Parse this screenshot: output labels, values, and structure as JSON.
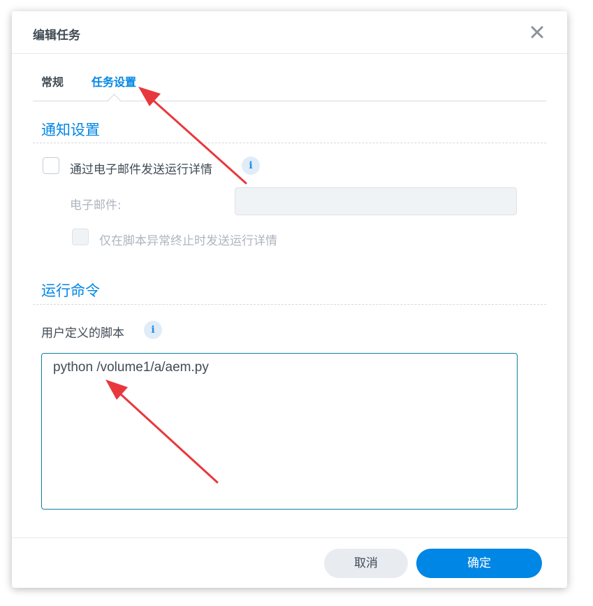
{
  "dialog": {
    "title": "编辑任务",
    "close_icon": "close-icon"
  },
  "tabs": [
    {
      "label": "常规",
      "active": false
    },
    {
      "label": "任务设置",
      "active": true
    }
  ],
  "notification": {
    "section_title": "通知设置",
    "send_email_label": "通过电子邮件发送运行详情",
    "send_email_checked": false,
    "email_label": "电子邮件:",
    "email_value": "",
    "abnormal_only_label": "仅在脚本异常终止时发送运行详情",
    "abnormal_only_checked": false
  },
  "run_command": {
    "section_title": "运行命令",
    "script_label": "用户定义的脚本",
    "script_value": "python /volume1/a/aem.py"
  },
  "footer": {
    "cancel_label": "取消",
    "ok_label": "确定"
  },
  "colors": {
    "accent": "#0086e5",
    "annotation_arrow": "#e8383d"
  },
  "icons": {
    "info": "info-icon",
    "close": "close-icon"
  }
}
